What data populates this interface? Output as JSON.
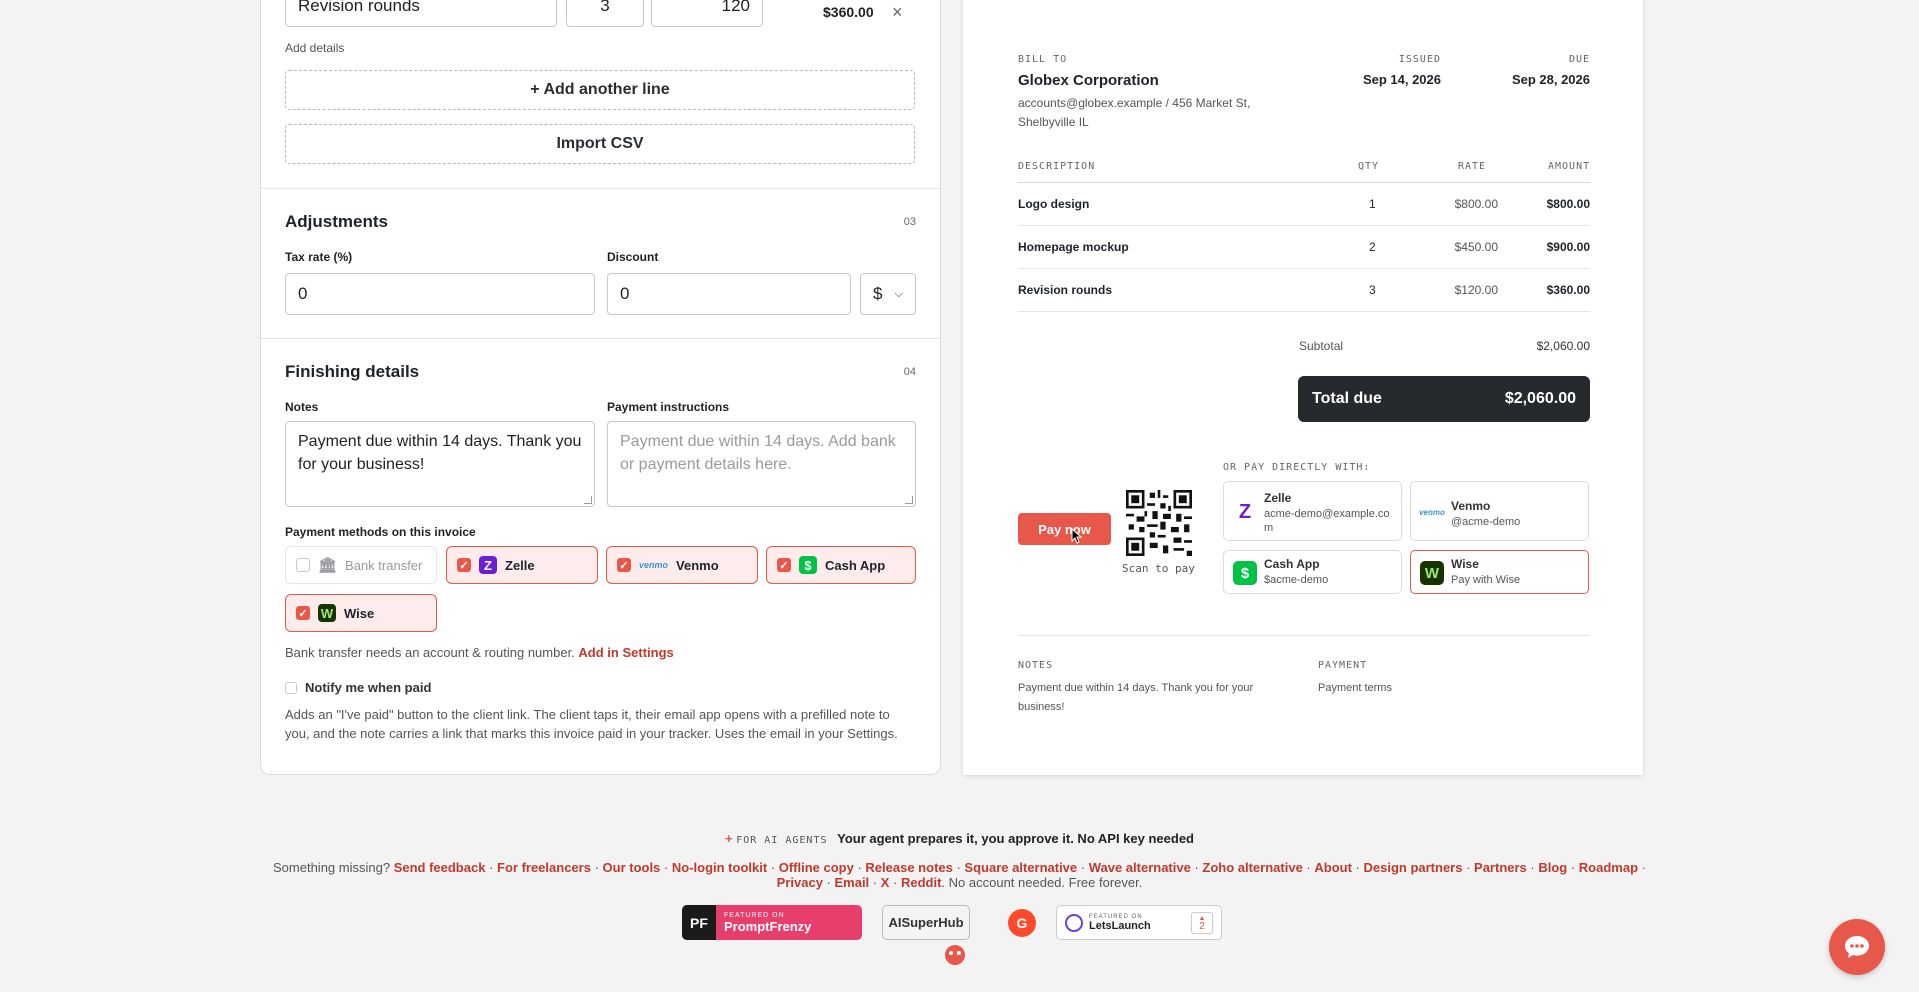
{
  "line_item": {
    "description": "Revision rounds",
    "qty": "3",
    "rate": "120",
    "amount": "$360.00",
    "remove": "×",
    "add_details": "Add details"
  },
  "line_actions": {
    "add_line": "+ Add another line",
    "import_csv": "Import CSV"
  },
  "adjustments": {
    "title": "Adjustments",
    "num": "03",
    "tax_label": "Tax rate (%)",
    "tax_value": "0",
    "discount_label": "Discount",
    "discount_value": "0",
    "discount_unit": "$"
  },
  "finishing": {
    "title": "Finishing details",
    "num": "04",
    "notes_label": "Notes",
    "notes_value": "Payment due within 14 days. Thank you for your business!",
    "payinst_label": "Payment instructions",
    "payinst_placeholder": "Payment due within 14 days. Add bank or payment details here.",
    "methods_label": "Payment methods on this invoice",
    "methods": [
      {
        "name": "Bank transfer",
        "checked": false
      },
      {
        "name": "Zelle",
        "checked": true
      },
      {
        "name": "Venmo",
        "checked": true
      },
      {
        "name": "Cash App",
        "checked": true
      },
      {
        "name": "Wise",
        "checked": true
      }
    ],
    "bank_note": "Bank transfer needs an account & routing number.",
    "bank_link": "Add in Settings",
    "notify_label": "Notify me when paid",
    "notify_help": "Adds an \"I've paid\" button to the client link. The client taps it, their email app opens with a prefilled note to you, and the note carries a link that marks this invoice paid in your tracker. Uses the email in your Settings."
  },
  "invoice": {
    "bill_to_label": "BILL TO",
    "client_name": "Globex Corporation",
    "client_address": "accounts@globex.example / 456 Market St, Shelbyville IL",
    "issued_label": "ISSUED",
    "issued": "Sep 14, 2026",
    "due_label": "DUE",
    "due": "Sep 28, 2026",
    "columns": [
      "DESCRIPTION",
      "QTY",
      "RATE",
      "AMOUNT"
    ],
    "rows": [
      {
        "desc": "Logo design",
        "qty": "1",
        "rate": "$800.00",
        "amount": "$800.00"
      },
      {
        "desc": "Homepage mockup",
        "qty": "2",
        "rate": "$450.00",
        "amount": "$900.00"
      },
      {
        "desc": "Revision rounds",
        "qty": "3",
        "rate": "$120.00",
        "amount": "$360.00"
      }
    ],
    "subtotal_label": "Subtotal",
    "subtotal": "$2,060.00",
    "total_label": "Total due",
    "total": "$2,060.00",
    "pay_now": "Pay now",
    "scan_label": "Scan to pay",
    "or_pay_label": "OR PAY DIRECTLY WITH:",
    "pay_options": [
      {
        "name": "Zelle",
        "detail": "acme-demo@example.com"
      },
      {
        "name": "Venmo",
        "detail": "@acme-demo"
      },
      {
        "name": "Cash App",
        "detail": "$acme-demo"
      },
      {
        "name": "Wise",
        "detail": "Pay with Wise"
      }
    ],
    "notes_label": "NOTES",
    "notes": "Payment due within 14 days. Thank you for your business!",
    "payment_label": "PAYMENT",
    "payment": "Payment terms"
  },
  "footer": {
    "ai_tag": "FOR AI AGENTS",
    "ai_text": "Your agent prepares it, you approve it. No API key needed",
    "missing": "Something missing?",
    "links_row1": [
      "Send feedback",
      "For freelancers",
      "Our tools",
      "No-login toolkit",
      "Offline copy",
      "Release notes",
      "Square alternative",
      "Wave alternative",
      "Zoho alternative",
      "About",
      "Design partners",
      "Partners",
      "Blog",
      "Roadmap"
    ],
    "links_row2": [
      "Privacy",
      "Email",
      "X",
      "Reddit"
    ],
    "tagline": "No account needed. Free forever.",
    "badge_pf_small": "FEATURED ON",
    "badge_pf": "PromptFrenzy",
    "badge_ai": "AISuperHub",
    "badge_ll_small": "FEATURED ON",
    "badge_ll": "LetsLaunch",
    "badge_ll_count": "2"
  },
  "colors": {
    "accent": "#e8584a",
    "dark": "#26292e",
    "link": "#c0392b"
  }
}
